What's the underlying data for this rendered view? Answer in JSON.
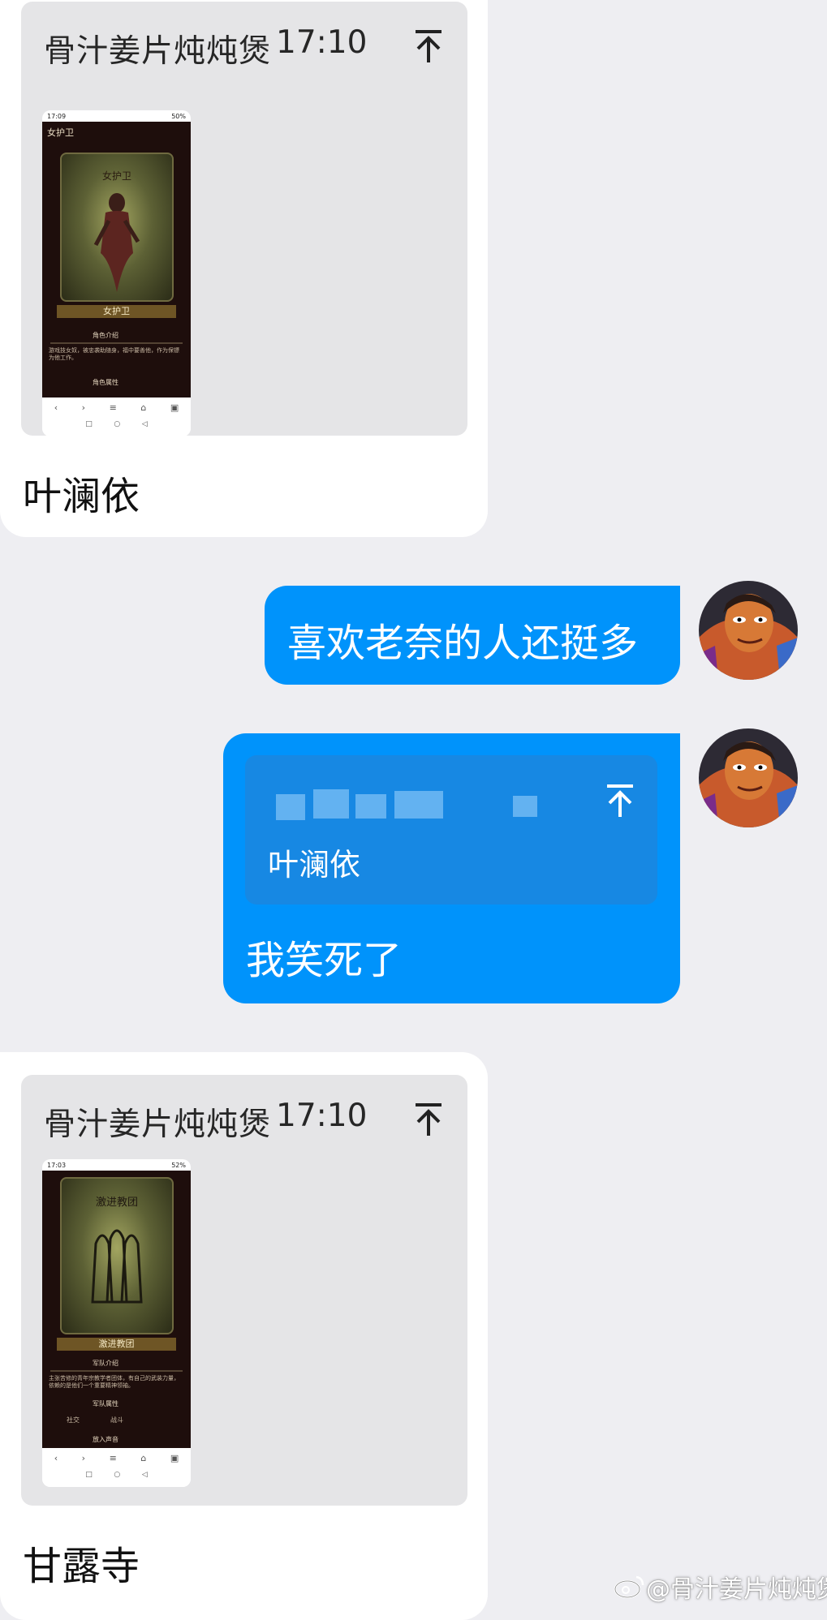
{
  "messages": [
    {
      "quote_sender": "骨汁姜片炖炖煲",
      "quote_time": "17:10",
      "thumbnail": {
        "status_time": "17:09",
        "battery": "50%",
        "header": "女护卫",
        "card_title": "女护卫",
        "banner": "女护卫",
        "section1": "角色介绍",
        "desc": "游戏技女奴，被忠袭助随身，福中要善他，作为保镖为他工作。",
        "section2": "角色属性"
      },
      "text": "叶澜依"
    },
    {
      "text": "喜欢老奈的人还挺多"
    },
    {
      "quote_text": "叶澜依",
      "text": "我笑死了"
    },
    {
      "quote_sender": "骨汁姜片炖炖煲",
      "quote_time": "17:10",
      "thumbnail": {
        "status_time": "17:03",
        "battery": "52%",
        "card_title": "激进教团",
        "banner": "激进教团",
        "section1": "军队介绍",
        "desc": "主张苦修的青年宗教学者团体，有自己的武装力量，依赖的是他们一个重要精神领袖。",
        "section2": "军队属性",
        "attr1": "社交",
        "attr2": "战斗",
        "section3": "放入声音"
      },
      "text": "甘露寺"
    }
  ],
  "watermark": "@骨汁姜片炖炖煲",
  "icons": [
    "pin-top-icon",
    "back-icon",
    "forward-icon",
    "menu-icon",
    "home-icon",
    "tabs-icon",
    "weibo-icon"
  ],
  "colors": {
    "background": "#eeeef2",
    "outgoing": "#0093fb",
    "quote_card": "#e5e5e7"
  }
}
